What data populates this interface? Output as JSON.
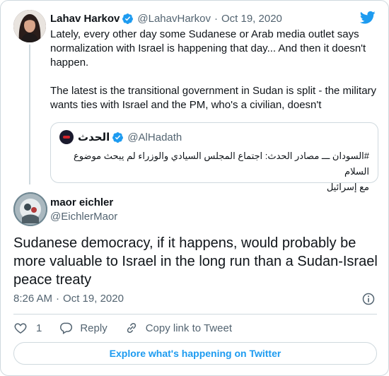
{
  "colors": {
    "accent": "#1d9bf0",
    "text": "#0f1419",
    "muted": "#536471",
    "border": "#cfd9de",
    "quote_logo_red": "#d0242b"
  },
  "parent_tweet": {
    "author_name": "Lahav Harkov",
    "author_handle": "@LahavHarkov",
    "separator": "·",
    "date": "Oct 19, 2020",
    "text_lines_p1": [
      "Lately, every other day some Sudanese or Arab media outlet says",
      "normalization with Israel is happening that day... And then it doesn't",
      "happen."
    ],
    "text_lines_p2": [
      "The latest is the transitional government in Sudan is split - the military",
      "wants ties with Israel and the PM, who's a civilian, doesn't"
    ],
    "icons": {
      "verified": "verified-badge-icon",
      "platform": "twitter-bird-icon"
    }
  },
  "quoted_tweet": {
    "author_name": "الحدث",
    "author_handle": "@AlHadath",
    "text_lines": [
      "#السودان ـــ مصادر الحدث: اجتماع المجلس السيادي والوزراء لم يبحث موضوع السلام",
      "مع إسرائيل"
    ]
  },
  "main_tweet": {
    "author_name": "maor eichler",
    "author_handle": "@EichlerMaor",
    "text_lines": [
      "Sudanese democracy, if it happens, would probably be",
      "more valuable to Israel in the long run than a Sudan-Israel",
      "peace treaty"
    ],
    "time": "8:26 AM",
    "separator": "·",
    "date": "Oct 19, 2020"
  },
  "actions": {
    "like_count": "1",
    "reply_label": "Reply",
    "copy_link_label": "Copy link to Tweet"
  },
  "explore_button": "Explore what's happening on Twitter"
}
